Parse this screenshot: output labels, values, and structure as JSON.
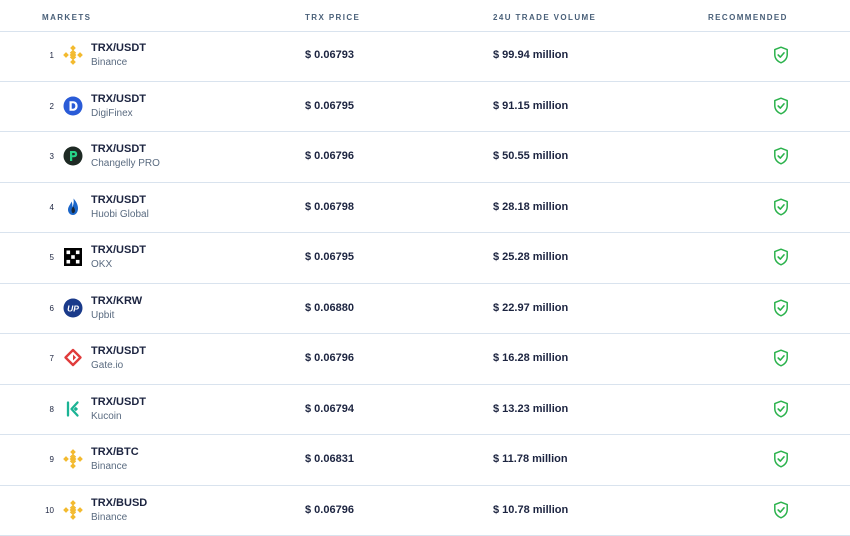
{
  "header": {
    "markets": "MARKETS",
    "price": "TRX PRICE",
    "volume": "24U TRADE VOLUME",
    "recommended": "RECOMMENDED"
  },
  "rows": [
    {
      "rank": "1",
      "pair": "TRX/USDT",
      "exchange": "Binance",
      "price": "$ 0.06793",
      "volume": "$ 99.94 million",
      "icon": "binance-icon"
    },
    {
      "rank": "2",
      "pair": "TRX/USDT",
      "exchange": "DigiFinex",
      "price": "$ 0.06795",
      "volume": "$ 91.15 million",
      "icon": "digifinex-icon"
    },
    {
      "rank": "3",
      "pair": "TRX/USDT",
      "exchange": "Changelly PRO",
      "price": "$ 0.06796",
      "volume": "$ 50.55 million",
      "icon": "changelly-icon"
    },
    {
      "rank": "4",
      "pair": "TRX/USDT",
      "exchange": "Huobi Global",
      "price": "$ 0.06798",
      "volume": "$ 28.18 million",
      "icon": "huobi-icon"
    },
    {
      "rank": "5",
      "pair": "TRX/USDT",
      "exchange": "OKX",
      "price": "$ 0.06795",
      "volume": "$ 25.28 million",
      "icon": "okx-icon"
    },
    {
      "rank": "6",
      "pair": "TRX/KRW",
      "exchange": "Upbit",
      "price": "$ 0.06880",
      "volume": "$ 22.97 million",
      "icon": "upbit-icon"
    },
    {
      "rank": "7",
      "pair": "TRX/USDT",
      "exchange": "Gate.io",
      "price": "$ 0.06796",
      "volume": "$ 16.28 million",
      "icon": "gateio-icon"
    },
    {
      "rank": "8",
      "pair": "TRX/USDT",
      "exchange": "Kucoin",
      "price": "$ 0.06794",
      "volume": "$ 13.23 million",
      "icon": "kucoin-icon"
    },
    {
      "rank": "9",
      "pair": "TRX/BTC",
      "exchange": "Binance",
      "price": "$ 0.06831",
      "volume": "$ 11.78 million",
      "icon": "binance-icon"
    },
    {
      "rank": "10",
      "pair": "TRX/BUSD",
      "exchange": "Binance",
      "price": "$ 0.06796",
      "volume": "$ 10.78 million",
      "icon": "binance-icon"
    }
  ],
  "colors": {
    "text": "#1c2440",
    "muted": "#5a6b80",
    "divider": "#d9e3ee",
    "recommended_green": "#2bb24c",
    "binance_yellow": "#f3ba2f"
  }
}
